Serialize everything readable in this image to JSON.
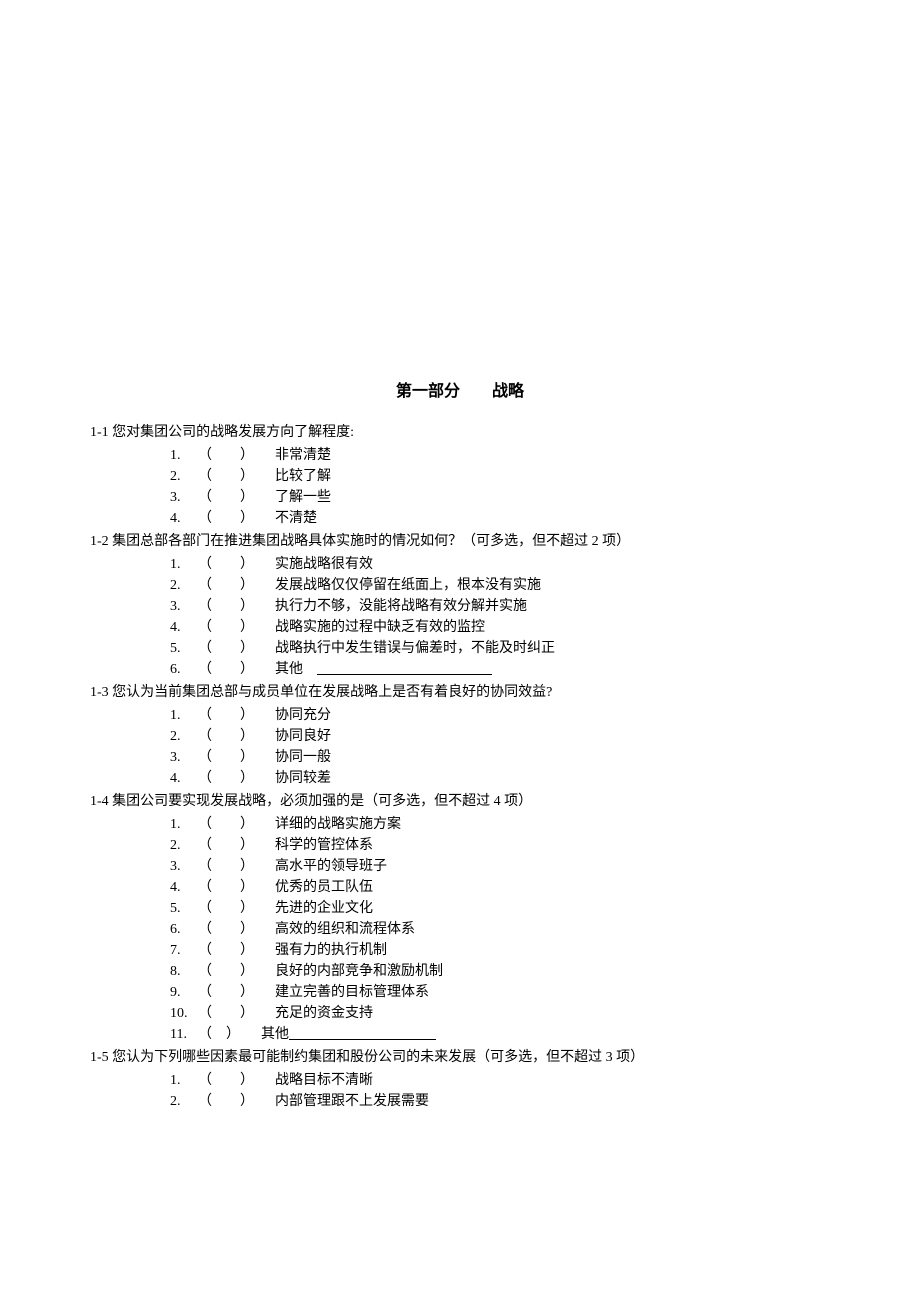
{
  "section_header": "第一部分　　战略",
  "questions": [
    {
      "id": "1-1",
      "text": "您对集团公司的战略发展方向了解程度:",
      "options": [
        {
          "n": "1.",
          "label": "非常清楚"
        },
        {
          "n": "2.",
          "label": "比较了解"
        },
        {
          "n": "3.",
          "label": "了解一些"
        },
        {
          "n": "4.",
          "label": "不清楚"
        }
      ]
    },
    {
      "id": "1-2",
      "text": "集团总部各部门在推进集团战略具体实施时的情况如何？（可多选，但不超过 2 项）",
      "options": [
        {
          "n": "1.",
          "label": "实施战略很有效"
        },
        {
          "n": "2.",
          "label": "发展战略仅仅停留在纸面上，根本没有实施"
        },
        {
          "n": "3.",
          "label": "执行力不够，没能将战略有效分解并实施"
        },
        {
          "n": "4.",
          "label": "战略实施的过程中缺乏有效的监控"
        },
        {
          "n": "5.",
          "label": "战略执行中发生错误与偏差时，不能及时纠正"
        },
        {
          "n": "6.",
          "label": "其他　",
          "blank": true,
          "blank_len": 50
        }
      ]
    },
    {
      "id": "1-3",
      "text": "您认为当前集团总部与成员单位在发展战略上是否有着良好的协同效益?",
      "options": [
        {
          "n": "1.",
          "label": "协同充分"
        },
        {
          "n": "2.",
          "label": "协同良好"
        },
        {
          "n": "3.",
          "label": "协同一般"
        },
        {
          "n": "4.",
          "label": "协同较差"
        }
      ]
    },
    {
      "id": "1-4",
      "text": "集团公司要实现发展战略，必须加强的是（可多选，但不超过 4 项）",
      "options": [
        {
          "n": "1.",
          "label": "详细的战略实施方案"
        },
        {
          "n": "2.",
          "label": "科学的管控体系"
        },
        {
          "n": "3.",
          "label": "高水平的领导班子"
        },
        {
          "n": "4.",
          "label": "优秀的员工队伍"
        },
        {
          "n": "5.",
          "label": "先进的企业文化"
        },
        {
          "n": "6.",
          "label": "高效的组织和流程体系"
        },
        {
          "n": "7.",
          "label": "强有力的执行机制"
        },
        {
          "n": "8.",
          "label": "良好的内部竞争和激励机制"
        },
        {
          "n": "9.",
          "label": "建立完善的目标管理体系"
        },
        {
          "n": "10.",
          "label": "充足的资金支持"
        },
        {
          "n": "11.",
          "label": "其他",
          "tight": true,
          "blank": true,
          "blank_len": 42
        }
      ]
    },
    {
      "id": "1-5",
      "text": "您认为下列哪些因素最可能制约集团和股份公司的未来发展（可多选，但不超过 3 项）",
      "options": [
        {
          "n": "1.",
          "label": "战略目标不清晰"
        },
        {
          "n": "2.",
          "label": "内部管理跟不上发展需要"
        }
      ]
    }
  ]
}
